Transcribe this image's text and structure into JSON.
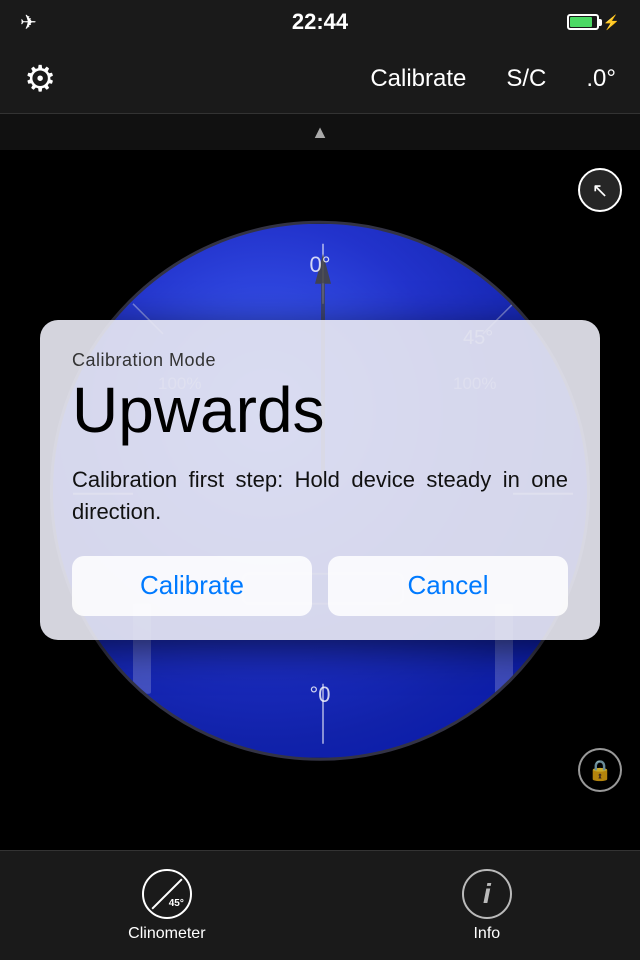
{
  "status": {
    "time": "22:44",
    "battery_level": 85
  },
  "toolbar": {
    "calibrate_label": "Calibrate",
    "sc_label": "S/C",
    "angle_label": ".0°"
  },
  "clinometer": {
    "top_label": "0°",
    "bottom_label": "°0",
    "label_45": "45°",
    "label_100": "100%",
    "label_100b": "100%"
  },
  "modal": {
    "subtitle": "Calibration Mode",
    "title": "Upwards",
    "description": "Calibration first step: Hold device steady in one direction.",
    "calibrate_btn": "Calibrate",
    "cancel_btn": "Cancel"
  },
  "tabs": {
    "clinometer_label": "Clinometer",
    "info_label": "Info",
    "clino_icon_text": "45°"
  }
}
